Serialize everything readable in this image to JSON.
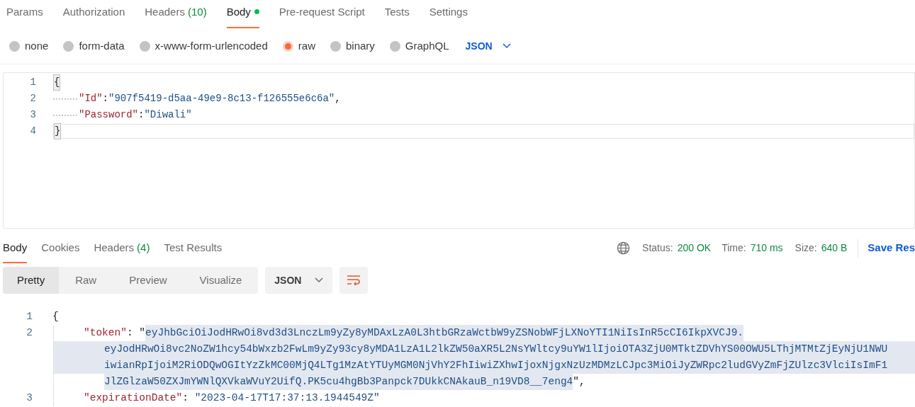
{
  "request_tabs": [
    {
      "label": "Params",
      "selected": false
    },
    {
      "label": "Authorization",
      "selected": false
    },
    {
      "label": "Headers",
      "count": "(10)",
      "selected": false
    },
    {
      "label": "Body",
      "selected": true,
      "dot": true
    },
    {
      "label": "Pre-request Script",
      "selected": false
    },
    {
      "label": "Tests",
      "selected": false
    },
    {
      "label": "Settings",
      "selected": false
    }
  ],
  "body_types": [
    {
      "label": "none",
      "selected": false
    },
    {
      "label": "form-data",
      "selected": false
    },
    {
      "label": "x-www-form-urlencoded",
      "selected": false
    },
    {
      "label": "raw",
      "selected": true
    },
    {
      "label": "binary",
      "selected": false
    },
    {
      "label": "GraphQL",
      "selected": false
    }
  ],
  "format_dropdown": "JSON",
  "request_body": [
    {
      "number": "1",
      "parts": [
        {
          "kind": "punct",
          "text": "{"
        }
      ],
      "indented": false,
      "current": false
    },
    {
      "number": "2",
      "parts": [
        {
          "kind": "key",
          "text": "\"Id\""
        },
        {
          "kind": "punct",
          "text": ":"
        },
        {
          "kind": "string",
          "text": "\"907f5419-d5aa-49e9-8c13-f126555e6c6a\""
        },
        {
          "kind": "punct",
          "text": ","
        }
      ],
      "indented": true,
      "current": false
    },
    {
      "number": "3",
      "parts": [
        {
          "kind": "key",
          "text": "\"Password\""
        },
        {
          "kind": "punct",
          "text": ":"
        },
        {
          "kind": "string",
          "text": "\"Diwali\""
        }
      ],
      "indented": true,
      "current": false
    },
    {
      "number": "4",
      "parts": [
        {
          "kind": "punct",
          "text": "}"
        }
      ],
      "indented": false,
      "current": true
    }
  ],
  "response_tabs": [
    {
      "label": "Body",
      "selected": true
    },
    {
      "label": "Cookies",
      "selected": false
    },
    {
      "label": "Headers",
      "count": "(4)",
      "selected": false
    },
    {
      "label": "Test Results",
      "selected": false
    }
  ],
  "status": {
    "label": "Status:",
    "value": "200 OK"
  },
  "time": {
    "label": "Time:",
    "value": "710 ms"
  },
  "size": {
    "label": "Size:",
    "value": "640 B"
  },
  "save_response": "Save Res",
  "view_modes": [
    {
      "label": "Pretty",
      "selected": true
    },
    {
      "label": "Raw",
      "selected": false
    },
    {
      "label": "Preview",
      "selected": false
    },
    {
      "label": "Visualize",
      "selected": false
    }
  ],
  "response_format": "JSON",
  "response_body": [
    {
      "number": "1",
      "kind": "open",
      "text": "{"
    },
    {
      "number": "2",
      "kind": "token",
      "key": "\"token\"",
      "sep": ": \"",
      "close": "\",",
      "lines": [
        "eyJhbGciOiJodHRwOi8vd3d3LnczLm9yZy8yMDAxLzA0L3htbGRzaWctbW9yZSNobWFjLXNoYTI1NiIsInR5cCI6IkpXVCJ9.",
        "eyJodHRwOi8vc2NoZW1hcy54bWxzb2FwLm9yZy93cy8yMDA1LzA1L2lkZW50aXR5L2NsYWltcy9uYW1lIjoiOTA3ZjU0MTktZDVhYS00OWU5LThjMTMtZjEyNjU1NWU",
        "iwianRpIjoiM2RiODQwOGItYzZkMC00MjQ4LTg1MzAtYTUyMGM0NjVhY2FhIiwiZXhwIjoxNjgxNzUzMDMzLCJpc3MiOiJyZWRpc2ludGVyZmFjZUlzc3VlciIsImF1",
        "JlZGlzaW50ZXJmYWNlQXVkaWVuY2UifQ.PK5cu4hgBb3Panpck7DUkkCNAkauB_n19VD8__7eng4"
      ]
    },
    {
      "number": "3",
      "kind": "pair",
      "key": "\"expirationDate\"",
      "sep": ": ",
      "value": "\"2023-04-17T17:37:13.1944549Z\""
    }
  ]
}
